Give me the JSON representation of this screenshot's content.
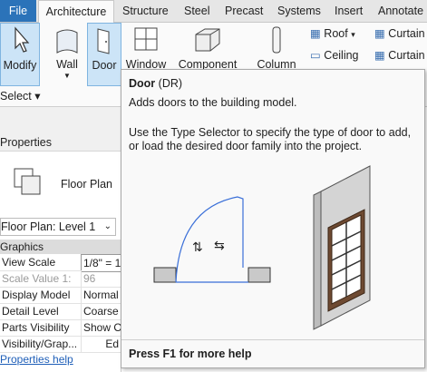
{
  "ribbon": {
    "tabs": [
      "File",
      "Architecture",
      "Structure",
      "Steel",
      "Precast",
      "Systems",
      "Insert",
      "Annotate"
    ],
    "tools": {
      "modify": "Modify",
      "wall": "Wall",
      "door": "Door",
      "window": "Window",
      "component": "Component",
      "column": "Column",
      "roof": "Roof",
      "ceiling": "Ceiling",
      "curtain1": "Curtain",
      "curtain2": "Curtain"
    },
    "select_label": "Select"
  },
  "properties": {
    "title": "Properties",
    "type_name": "Floor Plan",
    "instance_selector": "Floor Plan: Level 1",
    "group": "Graphics",
    "rows": [
      {
        "key": "View Scale",
        "value": "1/8\" = 1"
      },
      {
        "key": "Scale Value   1:",
        "value": "96"
      },
      {
        "key": "Display Model",
        "value": "Normal"
      },
      {
        "key": "Detail Level",
        "value": "Coarse"
      },
      {
        "key": "Parts Visibility",
        "value": "Show Or"
      },
      {
        "key": "Visibility/Grap...",
        "value": "Ed"
      }
    ],
    "help_link": "Properties help"
  },
  "tooltip": {
    "title": "Door",
    "shortcut": "(DR)",
    "description": "Adds doors to the building model.",
    "body": "Use the Type Selector to specify the type of door to add, or load the desired door family into the project.",
    "footer": "Press F1 for more help"
  }
}
